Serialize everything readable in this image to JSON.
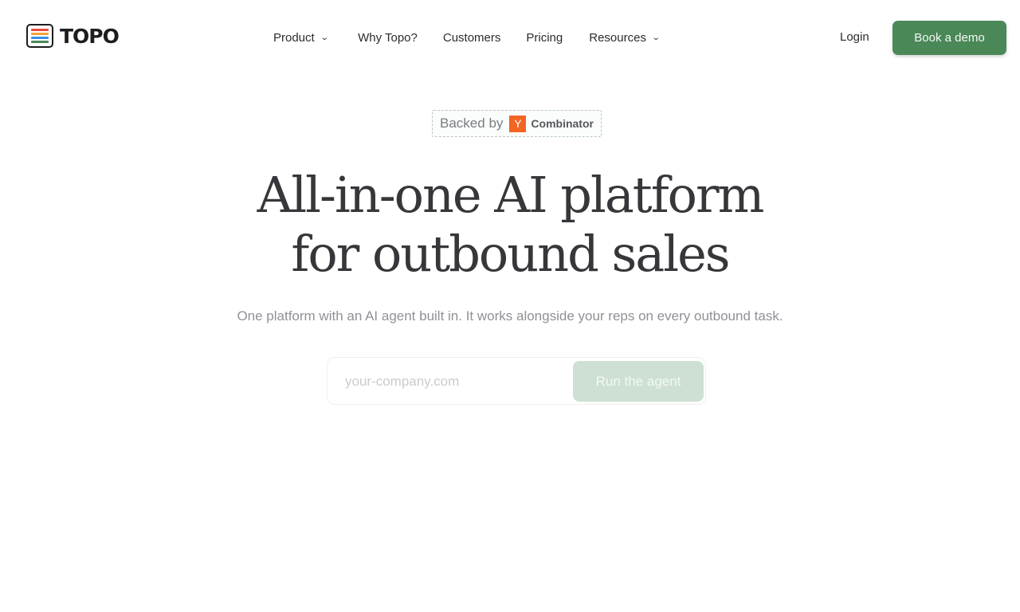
{
  "brand": {
    "name": "TOPO",
    "logo_stripes": [
      "#e94b3c",
      "#f4a23c",
      "#3a8ee8",
      "#4a8858"
    ]
  },
  "nav": {
    "items": [
      {
        "label": "Product",
        "has_dropdown": true
      },
      {
        "label": "Why Topo?",
        "has_dropdown": false
      },
      {
        "label": "Customers",
        "has_dropdown": false
      },
      {
        "label": "Pricing",
        "has_dropdown": false
      },
      {
        "label": "Resources",
        "has_dropdown": true
      }
    ],
    "chevron_icon": "chevron-down-icon"
  },
  "header": {
    "login_label": "Login",
    "demo_label": "Book a demo"
  },
  "badge": {
    "prefix": "Backed by",
    "yc_letter": "Y",
    "yc_word": "Combinator"
  },
  "hero": {
    "headline_line1": "All-in-one AI platform",
    "headline_line2": "for outbound sales",
    "subheadline": "One platform with an AI agent built in. It works alongside your reps on every outbound task."
  },
  "agent_form": {
    "input_value": "",
    "input_placeholder": "your-company.com",
    "button_label": "Run the agent"
  },
  "colors": {
    "accent": "#4a8858",
    "accent_disabled": "#cde0d3",
    "yc_orange": "#f26522"
  }
}
